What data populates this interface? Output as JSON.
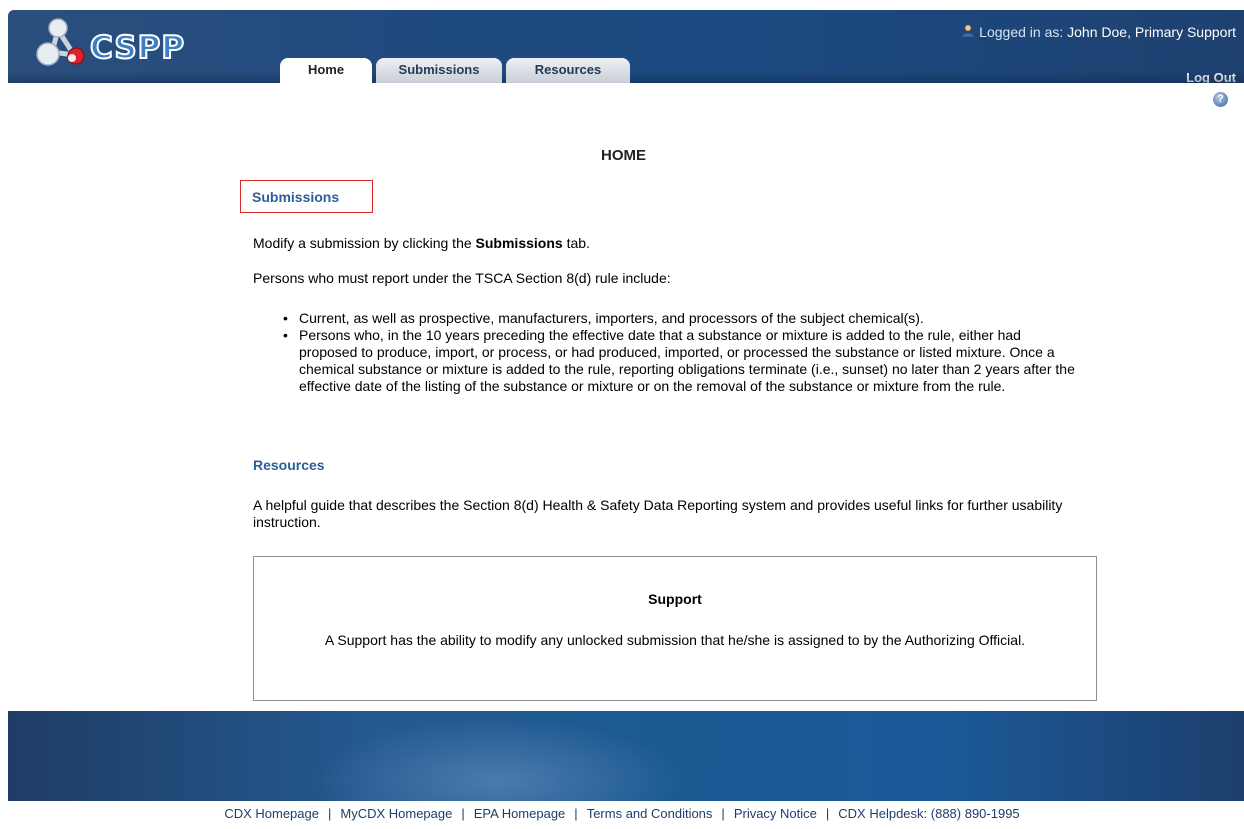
{
  "app": {
    "logo_text": "CSPP"
  },
  "header": {
    "login_label": "Logged in as:",
    "login_user": "John Doe, Primary Support",
    "logout": "Log Out"
  },
  "tabs": [
    {
      "label": "Home",
      "active": true
    },
    {
      "label": "Submissions",
      "active": false
    },
    {
      "label": "Resources",
      "active": false
    }
  ],
  "help": {
    "icon": "help-icon",
    "glyph": "?"
  },
  "main": {
    "title": "HOME",
    "submissions_heading": "Submissions",
    "p1_before": "Modify a submission by clicking the ",
    "p1_bold": "Submissions",
    "p1_after": " tab.",
    "p2": "Persons who must report under the TSCA Section 8(d) rule include:",
    "bullets": [
      "Current, as well as prospective, manufacturers, importers, and processors of the subject chemical(s).",
      "Persons who, in the 10 years preceding the effective date that a substance or mixture is added to the rule, either had proposed to produce, import, or process, or had produced, imported, or processed the substance or listed mixture. Once a chemical substance or mixture is added to the rule, reporting obligations terminate (i.e., sunset) no later than 2 years after the effective date of the listing of the substance or mixture or on the removal of the substance or mixture from the rule."
    ],
    "resources_heading": "Resources",
    "p3": "A helpful guide that describes the Section 8(d) Health & Safety Data Reporting system and provides useful links for further usability instruction.",
    "support": {
      "title": "Support",
      "text": "A Support has the ability to modify any unlocked submission that he/she is assigned to by the Authorizing Official."
    }
  },
  "footer": {
    "links": [
      "CDX Homepage",
      "MyCDX Homepage",
      "EPA Homepage",
      "Terms and Conditions",
      "Privacy Notice",
      "CDX Helpdesk: (888) 890-1995"
    ],
    "separator": "|"
  }
}
